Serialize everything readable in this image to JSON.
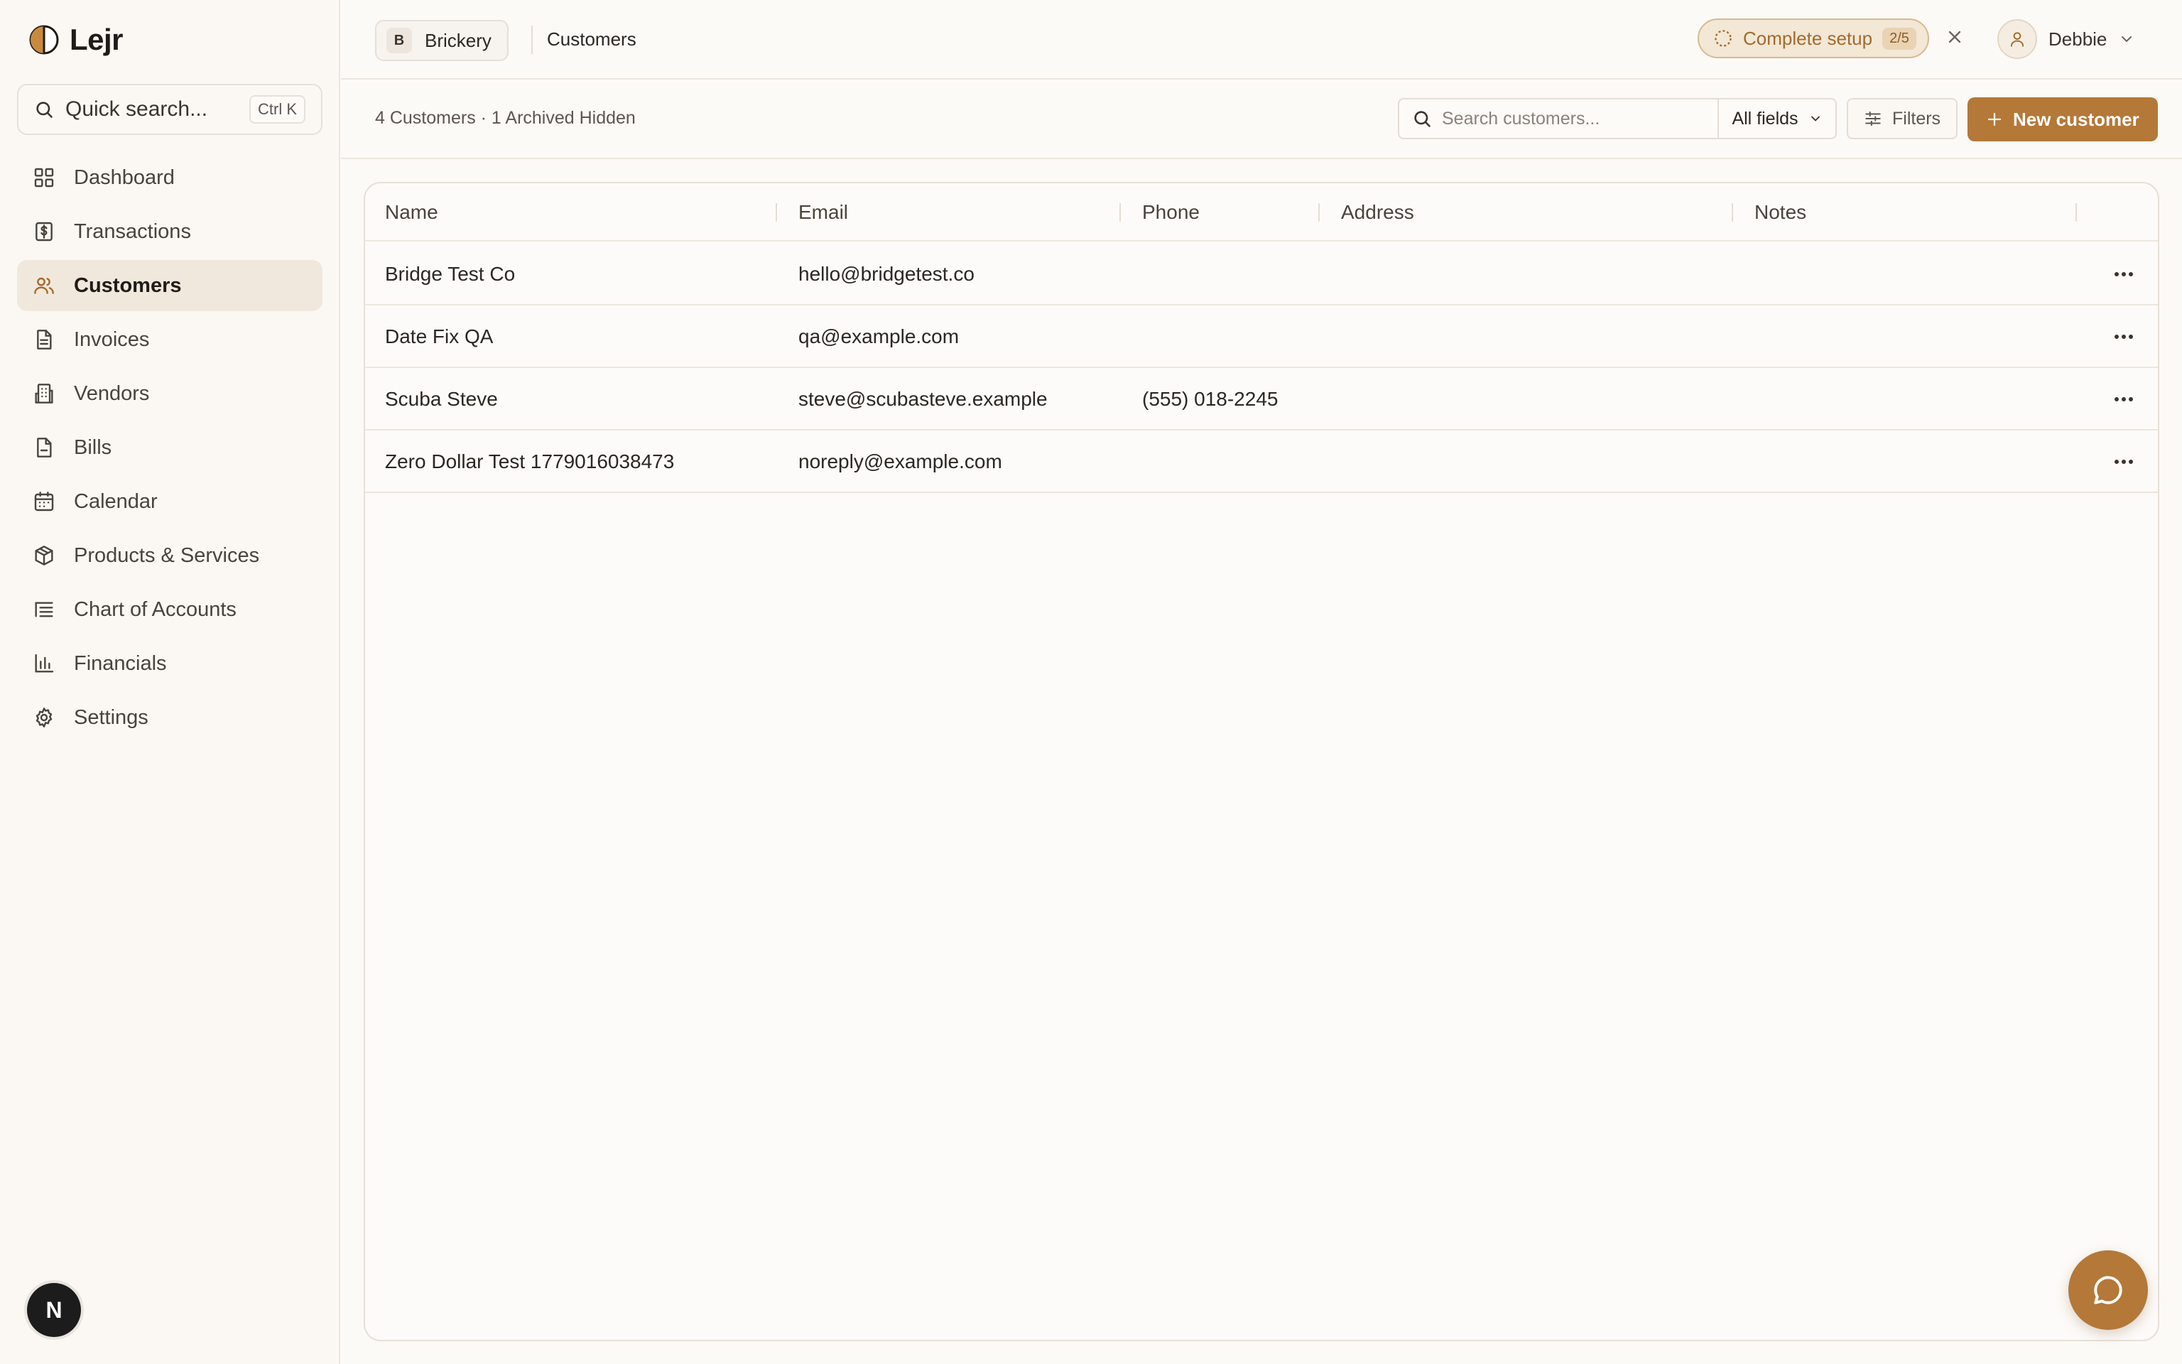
{
  "app": {
    "name": "Lejr"
  },
  "sidebar": {
    "quick_search": {
      "label": "Quick search...",
      "shortcut": "Ctrl K"
    },
    "items": [
      {
        "label": "Dashboard",
        "icon": "dashboard-icon"
      },
      {
        "label": "Transactions",
        "icon": "transactions-icon"
      },
      {
        "label": "Customers",
        "icon": "customers-icon",
        "active": true
      },
      {
        "label": "Invoices",
        "icon": "invoices-icon"
      },
      {
        "label": "Vendors",
        "icon": "vendors-icon"
      },
      {
        "label": "Bills",
        "icon": "bills-icon"
      },
      {
        "label": "Calendar",
        "icon": "calendar-icon"
      },
      {
        "label": "Products & Services",
        "icon": "package-icon"
      },
      {
        "label": "Chart of Accounts",
        "icon": "list-icon"
      },
      {
        "label": "Financials",
        "icon": "bar-chart-icon"
      },
      {
        "label": "Settings",
        "icon": "gear-icon"
      }
    ],
    "bottom_avatar": "N"
  },
  "header": {
    "workspace": {
      "badge": "B",
      "name": "Brickery"
    },
    "breadcrumb": "Customers",
    "setup": {
      "label": "Complete setup",
      "progress": "2/5"
    },
    "user": {
      "name": "Debbie"
    }
  },
  "toolbar": {
    "count_text": "4 Customers · 1 Archived Hidden",
    "search_placeholder": "Search customers...",
    "search_scope": "All fields",
    "filters_label": "Filters",
    "new_label": "New customer"
  },
  "table": {
    "columns": [
      "Name",
      "Email",
      "Phone",
      "Address",
      "Notes"
    ],
    "rows": [
      {
        "name": "Bridge Test Co",
        "email": "hello@bridgetest.co",
        "phone": "",
        "address": "",
        "notes": ""
      },
      {
        "name": "Date Fix QA",
        "email": "qa@example.com",
        "phone": "",
        "address": "",
        "notes": ""
      },
      {
        "name": "Scuba Steve",
        "email": "steve@scubasteve.example",
        "phone": "(555) 018-2245",
        "address": "",
        "notes": ""
      },
      {
        "name": "Zero Dollar Test 1779016038473",
        "email": "noreply@example.com",
        "phone": "",
        "address": "",
        "notes": ""
      }
    ]
  },
  "colors": {
    "accent": "#b47838",
    "active_nav": "#f1e8dd",
    "setup_text": "#a26b2c"
  }
}
